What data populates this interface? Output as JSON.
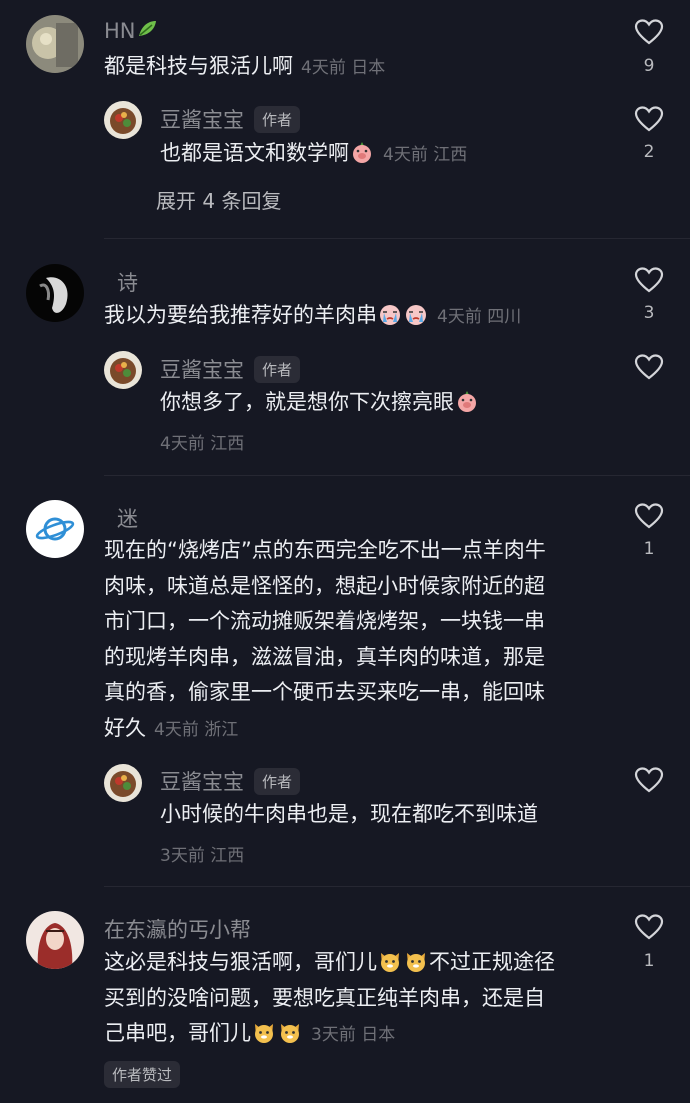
{
  "comments": [
    {
      "user": "HN",
      "text": "都是科技与狠活儿啊",
      "meta": "4天前 日本",
      "likes": "9",
      "reply": {
        "user": "豆酱宝宝",
        "badge": "作者",
        "text": "也都是语文和数学啊",
        "meta": "4天前 江西",
        "likes": "2"
      },
      "expand": "展开 4 条回复"
    },
    {
      "user": "诗",
      "text": "我以为要给我推荐好的羊肉串",
      "meta": "4天前 四川",
      "likes": "3",
      "reply": {
        "user": "豆酱宝宝",
        "badge": "作者",
        "text": "你想多了，就是想你下次擦亮眼",
        "meta": "4天前 江西"
      }
    },
    {
      "user": "迷",
      "lines": [
        "现在的“烧烤店”点的东西完全吃不出一点羊肉牛",
        "肉味，味道总是怪怪的，想起小时候家附近的超",
        "市门口，一个流动摊贩架着烧烤架，一块钱一串",
        "的现烤羊肉串，滋滋冒油，真羊肉的味道，那是",
        "真的香，偷家里一个硬币去买来吃一串，能回味",
        "好久"
      ],
      "meta": "4天前 浙江",
      "likes": "1",
      "reply": {
        "user": "豆酱宝宝",
        "badge": "作者",
        "text": "小时候的牛肉串也是，现在都吃不到味道",
        "meta": "3天前 江西"
      }
    },
    {
      "user": "在东瀛的丐小帮",
      "lines": [
        "这必是科技与狠活啊，哥们儿",
        "不过正规途径",
        "买到的没啥问题，要想吃真正纯羊肉串，还是自",
        "己串吧，哥们儿"
      ],
      "meta": "3天前 日本",
      "likes": "1",
      "author_liked": "作者赞过"
    }
  ]
}
